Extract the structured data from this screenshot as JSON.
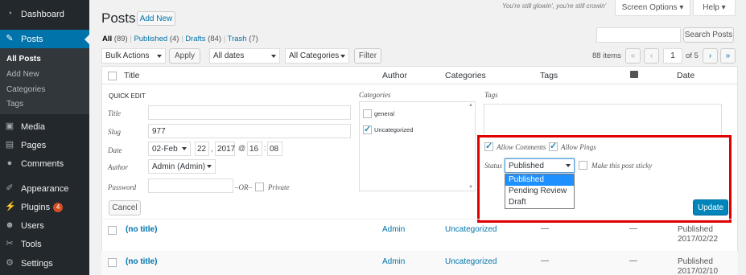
{
  "sidebar": {
    "items": [
      {
        "label": "Dashboard",
        "icon": "dashboard-icon"
      },
      {
        "label": "Posts",
        "icon": "pushpin-icon"
      },
      {
        "label": "Media",
        "icon": "media-icon"
      },
      {
        "label": "Pages",
        "icon": "pages-icon"
      },
      {
        "label": "Comments",
        "icon": "comments-icon"
      },
      {
        "label": "Appearance",
        "icon": "paintbrush-icon"
      },
      {
        "label": "Plugins",
        "icon": "plugins-icon",
        "badge": "4"
      },
      {
        "label": "Users",
        "icon": "users-icon"
      },
      {
        "label": "Tools",
        "icon": "tools-icon"
      },
      {
        "label": "Settings",
        "icon": "settings-icon"
      }
    ],
    "submenu": [
      "All Posts",
      "Add New",
      "Categories",
      "Tags"
    ]
  },
  "header": {
    "title": "Posts",
    "add_new": "Add New",
    "hello_dolly": "You're still glowin', you're still crowin'",
    "screen_options": "Screen Options",
    "help": "Help"
  },
  "filters": {
    "all": "All",
    "all_count": "(89)",
    "published": "Published",
    "published_count": "(4)",
    "drafts": "Drafts",
    "drafts_count": "(84)",
    "trash": "Trash",
    "trash_count": "(7)",
    "sep": "|"
  },
  "search": {
    "button": "Search Posts",
    "value": ""
  },
  "toolbar": {
    "bulk_actions": "Bulk Actions",
    "apply": "Apply",
    "all_dates": "All dates",
    "all_categories": "All Categories",
    "filter": "Filter",
    "items_count": "88 items",
    "first": "«",
    "prev": "‹",
    "page": "1",
    "of_pages": "of 5",
    "next": "›",
    "last": "»"
  },
  "columns": {
    "title": "Title",
    "author": "Author",
    "categories": "Categories",
    "tags": "Tags",
    "date": "Date"
  },
  "quick_edit": {
    "heading": "QUICK EDIT",
    "title_label": "Title",
    "title_value": "",
    "slug_label": "Slug",
    "slug_value": "977",
    "date_label": "Date",
    "month": "02-Feb",
    "day": "22",
    "year": "2017",
    "at": "@",
    "hour": "16",
    "colon": ":",
    "minute": "08",
    "author_label": "Author",
    "author_value": "Admin (Admin)",
    "password_label": "Password",
    "password_value": "",
    "or": "–OR–",
    "private_label": "Private",
    "categories_label": "Categories",
    "categories": [
      "general",
      "Uncategorized"
    ],
    "tags_label": "Tags",
    "allow_comments": "Allow Comments",
    "allow_pings": "Allow Pings",
    "status_label": "Status",
    "status_value": "Published",
    "status_options": [
      "Published",
      "Pending Review",
      "Draft"
    ],
    "sticky_label": "Make this post sticky",
    "cancel": "Cancel",
    "update": "Update"
  },
  "rows": [
    {
      "title": "(no title)",
      "author": "Admin",
      "category": "Uncategorized",
      "tags": "—",
      "comments": "—",
      "status": "Published",
      "date": "2017/02/22"
    },
    {
      "title": "(no title)",
      "author": "Admin",
      "category": "Uncategorized",
      "tags": "—",
      "comments": "—",
      "status": "Published",
      "date": "2017/02/10"
    }
  ],
  "colors": {
    "sidebar": "#23282d",
    "accent": "#0073aa",
    "highlight": "#e00000",
    "update_button": "#0085ba"
  }
}
